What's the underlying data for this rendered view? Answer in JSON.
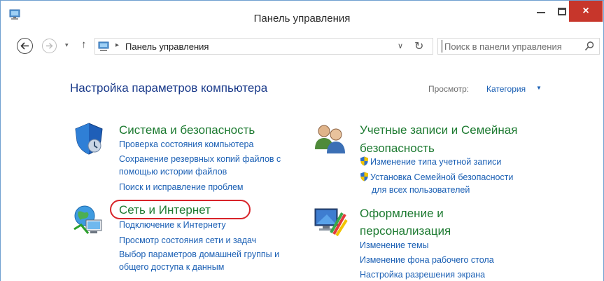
{
  "window": {
    "title": "Панель управления",
    "close_glyph": "×",
    "accent_close": "#c7362b"
  },
  "nav": {
    "back_glyph": "←",
    "forward_glyph": "→",
    "recent_glyph": "▾",
    "up_glyph": "↑",
    "address_separator": "▸",
    "address_text": "Панель управления",
    "address_dropdown_glyph": "∨",
    "refresh_glyph": "↻",
    "search_placeholder": "Поиск в панели управления"
  },
  "content": {
    "page_title": "Настройка параметров компьютера",
    "view_label": "Просмотр:",
    "view_value": "Категория",
    "view_arrow": "▼",
    "categories": [
      {
        "title": "Система и безопасность",
        "icon": "shield-system-icon",
        "links": [
          "Проверка состояния компьютера",
          "Сохранение резервных копий файлов с",
          "помощью истории файлов",
          "Поиск и исправление проблем"
        ]
      },
      {
        "title": "Сеть и Интернет",
        "icon": "network-globe-icon",
        "links": [
          "Подключение к Интернету",
          "Просмотр состояния сети и задач",
          "Выбор параметров домашней группы и",
          "общего доступа к данным"
        ]
      },
      {
        "title_line1": "Учетные записи и Семейная",
        "title_line2": "безопасность",
        "icon": "user-accounts-icon",
        "links": [
          "Изменение типа учетной записи",
          "Установка Семейной безопасности",
          "для всех пользователей"
        ]
      },
      {
        "title_line1": "Оформление и",
        "title_line2": "персонализация",
        "icon": "appearance-monitor-icon",
        "links": [
          "Изменение темы",
          "Изменение фона рабочего стола",
          "Настройка разрешения экрана"
        ]
      }
    ],
    "highlight_color": "#d8242a"
  }
}
